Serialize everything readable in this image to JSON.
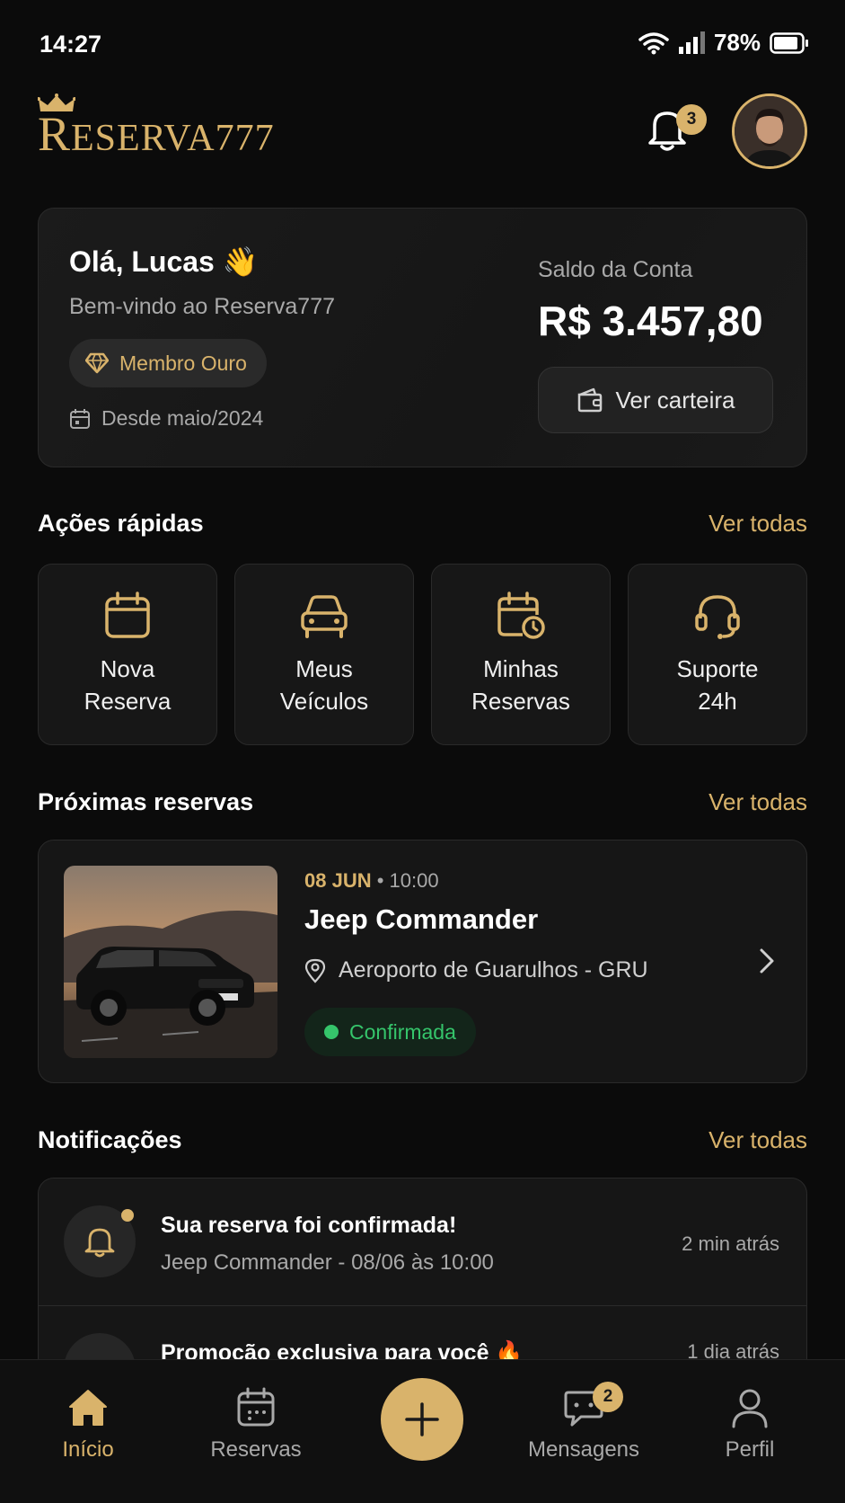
{
  "status_bar": {
    "time": "14:27",
    "battery": "78%"
  },
  "header": {
    "logo_text": "Reserva777",
    "logo_initial": "R",
    "logo_rest": "ESERVA777",
    "notification_count": "3"
  },
  "welcome": {
    "greeting": "Olá, Lucas 👋",
    "subtitle": "Bem-vindo ao Reserva777",
    "membership": "Membro Ouro",
    "since": "Desde maio/2024",
    "balance_label": "Saldo da Conta",
    "balance_value": "R$ 3.457,80",
    "wallet_button": "Ver carteira"
  },
  "quick_actions": {
    "title": "Ações rápidas",
    "link": "Ver todas",
    "items": [
      {
        "label": "Nova\nReserva",
        "icon": "calendar-icon"
      },
      {
        "label": "Meus\nVeículos",
        "icon": "car-icon"
      },
      {
        "label": "Minhas\nReservas",
        "icon": "calendar-clock-icon"
      },
      {
        "label": "Suporte\n24h",
        "icon": "headset-icon"
      }
    ]
  },
  "upcoming": {
    "title": "Próximas reservas",
    "link": "Ver todas",
    "reservation": {
      "date": "08 JUN",
      "separator": "•",
      "time": "10:00",
      "vehicle": "Jeep Commander",
      "location": "Aeroporto de Guarulhos - GRU",
      "status": "Confirmada"
    }
  },
  "notifications": {
    "title": "Notificações",
    "link": "Ver todas",
    "items": [
      {
        "title": "Sua reserva foi confirmada!",
        "subtitle": "Jeep Commander - 08/06 às 10:00",
        "time": "2 min atrás"
      },
      {
        "title": "Promoção exclusiva para você 🔥",
        "subtitle": "",
        "time": "1 dia atrás"
      }
    ]
  },
  "bottom_nav": {
    "items": [
      {
        "label": "Início",
        "active": true
      },
      {
        "label": "Reservas"
      },
      {
        "label": "Mensagens",
        "badge": "2"
      },
      {
        "label": "Perfil"
      }
    ]
  },
  "colors": {
    "accent": "#d9b36b",
    "background": "#0b0b0b",
    "success": "#35c56b"
  }
}
